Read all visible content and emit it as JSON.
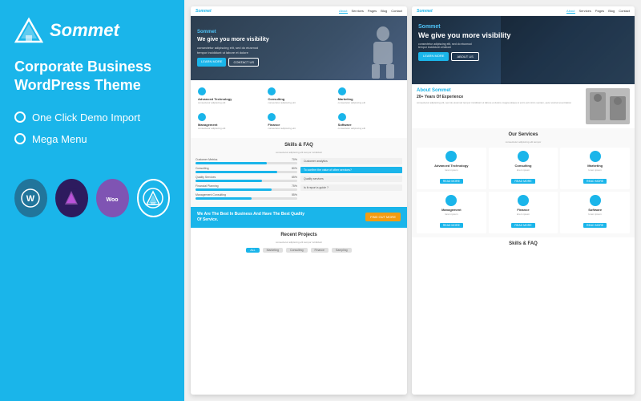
{
  "left": {
    "logo": "Sommet",
    "title_line1": "Corporate Business",
    "title_line2": "WordPress Theme",
    "features": [
      "One Click Demo Import",
      "Mega Menu"
    ],
    "tech_icons": [
      {
        "name": "WordPress",
        "abbr": "W",
        "color": "#21759b"
      },
      {
        "name": "Avada",
        "abbr": "A",
        "color": "#2d1b5e"
      },
      {
        "name": "WooCommerce",
        "abbr": "Woo",
        "color": "#7f54b3"
      },
      {
        "name": "Sommet",
        "abbr": "S",
        "color": "#1ab5ea"
      }
    ]
  },
  "preview_left": {
    "nav": {
      "logo": "Sommet",
      "links": [
        "About",
        "Services",
        "Pages",
        "Blog",
        "Contact"
      ]
    },
    "hero": {
      "brand": "Sommet",
      "headline": "We give you more visibility",
      "subtext": "consectetur adipiscing elit, sed do eiusmod tempor incididunt ut labore et dolore magna aliqua ut enim ad minim",
      "btn1": "LEARN MORE",
      "btn2": "CONTACT US"
    },
    "services": [
      {
        "title": "Advanced Technology",
        "text": "consectetur adipiscing elit, sed do eiusmod tempor"
      },
      {
        "title": "Consulting",
        "text": "consectetur adipiscing elit, sed do eiusmod tempor"
      },
      {
        "title": "Marketing",
        "text": "consectetur adipiscing elit, sed do eiusmod tempor"
      },
      {
        "title": "Management",
        "text": "consectetur adipiscing elit, sed do eiusmod tempor"
      },
      {
        "title": "Finance",
        "text": "consectetur adipiscing elit, sed do eiusmod tempor"
      },
      {
        "title": "Software",
        "text": "consectetur adipiscing elit, sed do eiusmod tempor"
      }
    ],
    "skills_section": {
      "title": "Skills & FAQ",
      "subtitle": "consectetur adipiscing elit, sed do eiusmod tempor incididunt ut labore et dolore magna",
      "skills": [
        {
          "label": "Customer Metrics",
          "percent": 70
        },
        {
          "label": "Consulting",
          "percent": 80
        },
        {
          "label": "Quality Services",
          "percent": 65
        },
        {
          "label": "Financial Planning",
          "percent": 75
        },
        {
          "label": "Management Consulting",
          "percent": 55
        }
      ],
      "faq": [
        {
          "q": "Customer analytics",
          "active": false
        },
        {
          "q": "To confirm the value of other services?",
          "active": true
        },
        {
          "q": "Quality services",
          "active": false
        },
        {
          "q": "Is it report a guide ?",
          "active": false
        }
      ]
    },
    "cta": {
      "text_line1": "We Are The Best In Business And Have The Best Quality",
      "text_line2": "Of Service.",
      "btn": "FIND OUT MORE"
    },
    "projects": {
      "title": "Recent Projects",
      "subtitle": "consectetur adipiscing elit, sed do eiusmod tempor incididunt ut labore et dolore magna",
      "filters": [
        "ALL",
        "Marketing",
        "Consulting",
        "Finance",
        "Sampling"
      ]
    }
  },
  "preview_right": {
    "nav": {
      "logo": "Sommet",
      "links": [
        "About",
        "Services",
        "Pages",
        "Blog",
        "Contact"
      ]
    },
    "hero": {
      "brand": "Sommet",
      "headline": "We give you more visibility",
      "subtext": "consectetur adipiscing elit, sed do eiusmod tempor incididunt",
      "btn1": "LEARN MORE",
      "btn2": "ABOUT US"
    },
    "about": {
      "title": "About Sommet",
      "subtitle": "20+ Years Of Experience",
      "body": "consectetur adipiscing elit, sed do eiusmod tempor incididunt ut labore et dolore magna aliqua ut enim ad minim veniam, quis nostrud exercitation ullamco laboris nisi ut aliquip ex ea commodo consequat duis aute irure dolor in reprehenderit in voluptate velit esse cillum dolore eu fugiat nulla pariatur"
    },
    "services": {
      "title": "Our Services",
      "subtitle": "consectetur adipiscing elit, sed do eiusmod tempor",
      "items": [
        {
          "title": "Advanced Technology",
          "text": "consectetur adipiscing"
        },
        {
          "title": "Consulting",
          "text": "consectetur adipiscing"
        },
        {
          "title": "Marketing",
          "text": "consectetur adipiscing"
        },
        {
          "title": "Management",
          "text": "consectetur adipiscing"
        },
        {
          "title": "Finance",
          "text": "consectetur adipiscing"
        },
        {
          "title": "Software",
          "text": "consectetur adipiscing"
        }
      ]
    },
    "skills_title": "Skills & FAQ"
  },
  "colors": {
    "primary": "#1ab5ea",
    "dark": "#2c3e50",
    "cta_orange": "#f39c12"
  }
}
